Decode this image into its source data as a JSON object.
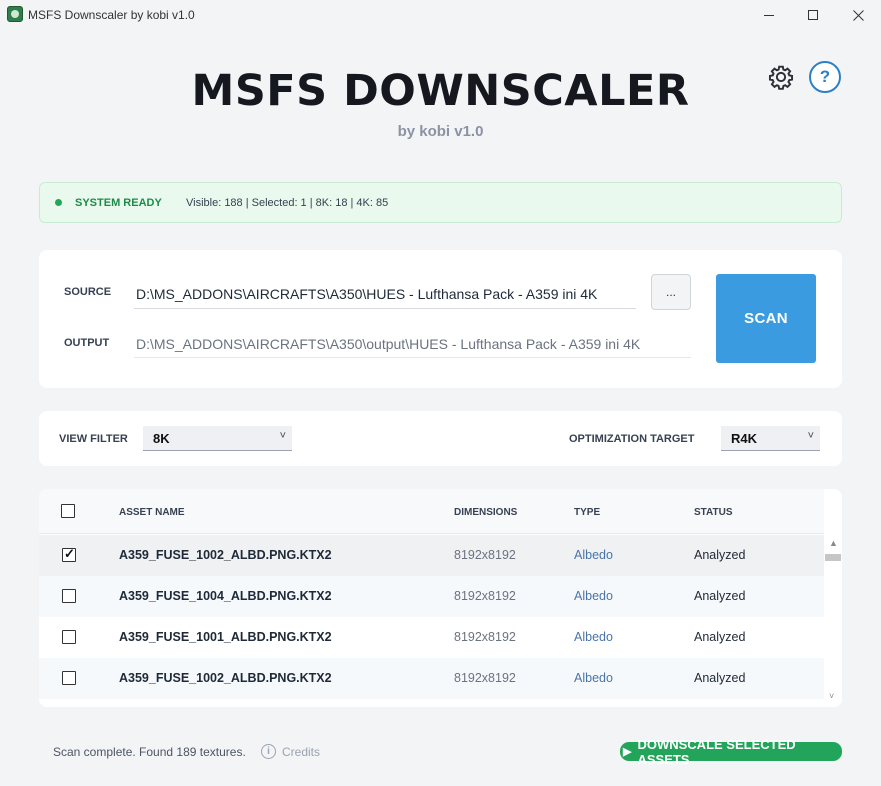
{
  "window": {
    "title": "MSFS Downscaler by kobi v1.0",
    "icons": {
      "app": "app-icon",
      "minimize": "minimize-icon",
      "maximize": "maximize-icon",
      "close": "close-icon"
    }
  },
  "header": {
    "title": "MSFS DOWNSCALER",
    "subtitle": "by kobi v1.0",
    "settings_icon": "gear-icon",
    "help_label": "?"
  },
  "status": {
    "label": "SYSTEM READY",
    "stats": "Visible: 188 | Selected: 1 | 8K: 18 | 4K: 85",
    "color": "#22a65a"
  },
  "paths": {
    "source_label": "SOURCE",
    "source_value": "D:\\MS_ADDONS\\AIRCRAFTS\\A350\\HUES - Lufthansa Pack - A359 ini 4K",
    "output_label": "OUTPUT",
    "output_value": "D:\\MS_ADDONS\\AIRCRAFTS\\A350\\output\\HUES - Lufthansa Pack - A359 ini 4K",
    "browse_label": "...",
    "scan_label": "SCAN"
  },
  "filters": {
    "view_filter_label": "VIEW FILTER",
    "view_filter_value": "8K",
    "optimization_label": "OPTIMIZATION TARGET",
    "optimization_value": "R4K"
  },
  "table": {
    "columns": [
      "ASSET NAME",
      "DIMENSIONS",
      "TYPE",
      "STATUS"
    ],
    "rows": [
      {
        "checked": true,
        "name": "A359_FUSE_1002_ALBD.PNG.KTX2",
        "dimensions": "8192x8192",
        "type": "Albedo",
        "status": "Analyzed"
      },
      {
        "checked": false,
        "name": "A359_FUSE_1004_ALBD.PNG.KTX2",
        "dimensions": "8192x8192",
        "type": "Albedo",
        "status": "Analyzed"
      },
      {
        "checked": false,
        "name": "A359_FUSE_1001_ALBD.PNG.KTX2",
        "dimensions": "8192x8192",
        "type": "Albedo",
        "status": "Analyzed"
      },
      {
        "checked": false,
        "name": "A359_FUSE_1002_ALBD.PNG.KTX2",
        "dimensions": "8192x8192",
        "type": "Albedo",
        "status": "Analyzed"
      }
    ]
  },
  "footer": {
    "status_text": "Scan complete. Found 189 textures.",
    "credits_label": "Credits",
    "info_icon_glyph": "i",
    "downscale_label": "DOWNSCALE SELECTED ASSETS",
    "accent": "#22a55a"
  }
}
